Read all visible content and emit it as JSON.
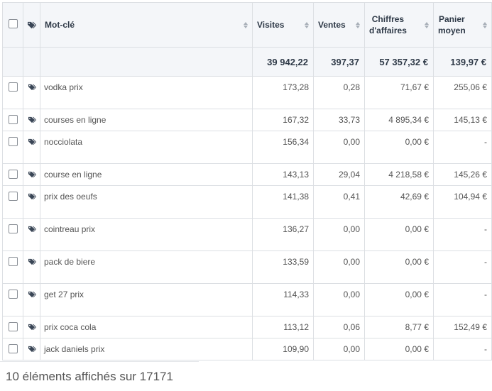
{
  "columns": {
    "keyword": "Mot-clé",
    "visits": "Visites",
    "sales": "Ventes",
    "revenue_line1": "Chiffres",
    "revenue_line2": "d'affaires",
    "basket_line1": "Panier",
    "basket_line2": "moyen"
  },
  "totals": {
    "visits": "39 942,22",
    "sales": "397,37",
    "revenue": "57 357,32 €",
    "basket": "139,97 €"
  },
  "rows": [
    {
      "keyword": "vodka prix",
      "visits": "173,28",
      "sales": "0,28",
      "revenue": "71,67 €",
      "basket": "255,06 €"
    },
    {
      "keyword": "courses en ligne",
      "visits": "167,32",
      "sales": "33,73",
      "revenue": "4 895,34 €",
      "basket": "145,13 €"
    },
    {
      "keyword": "nocciolata",
      "visits": "156,34",
      "sales": "0,00",
      "revenue": "0,00 €",
      "basket": "-"
    },
    {
      "keyword": "course en ligne",
      "visits": "143,13",
      "sales": "29,04",
      "revenue": "4 218,58 €",
      "basket": "145,26 €"
    },
    {
      "keyword": "prix des oeufs",
      "visits": "141,38",
      "sales": "0,41",
      "revenue": "42,69 €",
      "basket": "104,94 €"
    },
    {
      "keyword": "cointreau prix",
      "visits": "136,27",
      "sales": "0,00",
      "revenue": "0,00 €",
      "basket": "-"
    },
    {
      "keyword": "pack de biere",
      "visits": "133,59",
      "sales": "0,00",
      "revenue": "0,00 €",
      "basket": "-"
    },
    {
      "keyword": "get 27 prix",
      "visits": "114,33",
      "sales": "0,00",
      "revenue": "0,00 €",
      "basket": "-"
    },
    {
      "keyword": "prix coca cola",
      "visits": "113,12",
      "sales": "0,06",
      "revenue": "8,77 €",
      "basket": "152,49 €"
    },
    {
      "keyword": "jack daniels prix",
      "visits": "109,90",
      "sales": "0,00",
      "revenue": "0,00 €",
      "basket": "-"
    }
  ],
  "footer": {
    "summary": "10 éléments affichés sur 17171"
  },
  "icons": {
    "tag": "tag-icon",
    "sort": "sort-icon",
    "checkbox": "checkbox"
  },
  "colors": {
    "header_bg": "#f4f6f9",
    "border": "#dcdfe3",
    "header_text": "#2f3a48"
  }
}
